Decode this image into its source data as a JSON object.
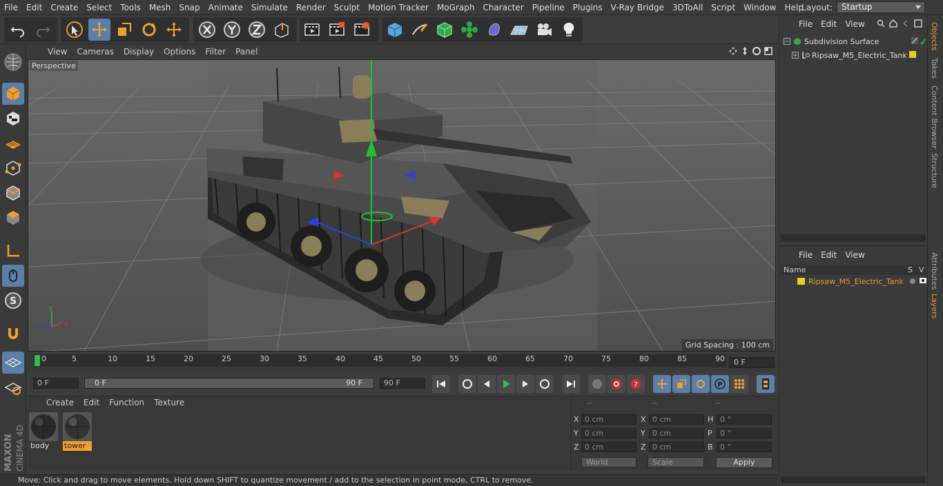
{
  "menubar": {
    "items": [
      "File",
      "Edit",
      "Create",
      "Select",
      "Tools",
      "Mesh",
      "Snap",
      "Animate",
      "Simulate",
      "Render",
      "Sculpt",
      "Motion Tracker",
      "MoGraph",
      "Character",
      "Pipeline",
      "Plugins",
      "V-Ray Bridge",
      "3DToAll",
      "Script",
      "Window",
      "Help"
    ],
    "layout_label": "Layout:",
    "layout_value": "Startup"
  },
  "viewport": {
    "menu": [
      "View",
      "Cameras",
      "Display",
      "Options",
      "Filter",
      "Panel"
    ],
    "camera_label": "Perspective",
    "grid_spacing": "Grid Spacing : 100 cm"
  },
  "timeline": {
    "ticks": [
      "0",
      "5",
      "10",
      "15",
      "20",
      "25",
      "30",
      "35",
      "40",
      "45",
      "50",
      "55",
      "60",
      "65",
      "70",
      "75",
      "80",
      "85",
      "90"
    ],
    "current_frame": "0 F",
    "start_field": "0 F",
    "range_start": "0 F",
    "range_end": "90 F",
    "end_field": "90 F"
  },
  "materials": {
    "menu": [
      "Create",
      "Edit",
      "Function",
      "Texture"
    ],
    "items": [
      {
        "name": "body",
        "selected": false
      },
      {
        "name": "tower",
        "selected": true
      }
    ]
  },
  "coords": {
    "headers": [
      "--",
      "--",
      "--"
    ],
    "rows": [
      {
        "a": "X",
        "av": "0 cm",
        "b": "X",
        "bv": "0 cm",
        "c": "H",
        "cv": "0 °"
      },
      {
        "a": "Y",
        "av": "0 cm",
        "b": "Y",
        "bv": "0 cm",
        "c": "P",
        "cv": "0 °"
      },
      {
        "a": "Z",
        "av": "0 cm",
        "b": "Z",
        "bv": "0 cm",
        "c": "B",
        "cv": "0 °"
      }
    ],
    "space": "World",
    "mode": "Scale",
    "apply": "Apply"
  },
  "status": "Move: Click and drag to move elements. Hold down SHIFT to quantize movement / add to the selection in point mode, CTRL to remove.",
  "object_manager": {
    "menu": [
      "File",
      "Edit",
      "View"
    ],
    "objects": [
      {
        "name": "Subdivision Surface"
      },
      {
        "name": "Ripsaw_M5_Electric_Tank"
      }
    ]
  },
  "layer_manager": {
    "menu": [
      "File",
      "Edit",
      "View"
    ],
    "col_name": "Name",
    "col_s": "S",
    "col_v": "V",
    "layers": [
      {
        "name": "Ripsaw_M5_Electric_Tank",
        "color": "#e8d020"
      }
    ]
  },
  "side_tabs": [
    "Objects",
    "Takes",
    "Content Browser",
    "Structure",
    "Attributes",
    "Layers"
  ],
  "brand": {
    "maxon": "MAXON",
    "product": "CINEMA 4D"
  },
  "colors": {
    "accent": "#5b7fa8",
    "selected_text": "#e0a030",
    "layer_yellow": "#e8d020"
  }
}
